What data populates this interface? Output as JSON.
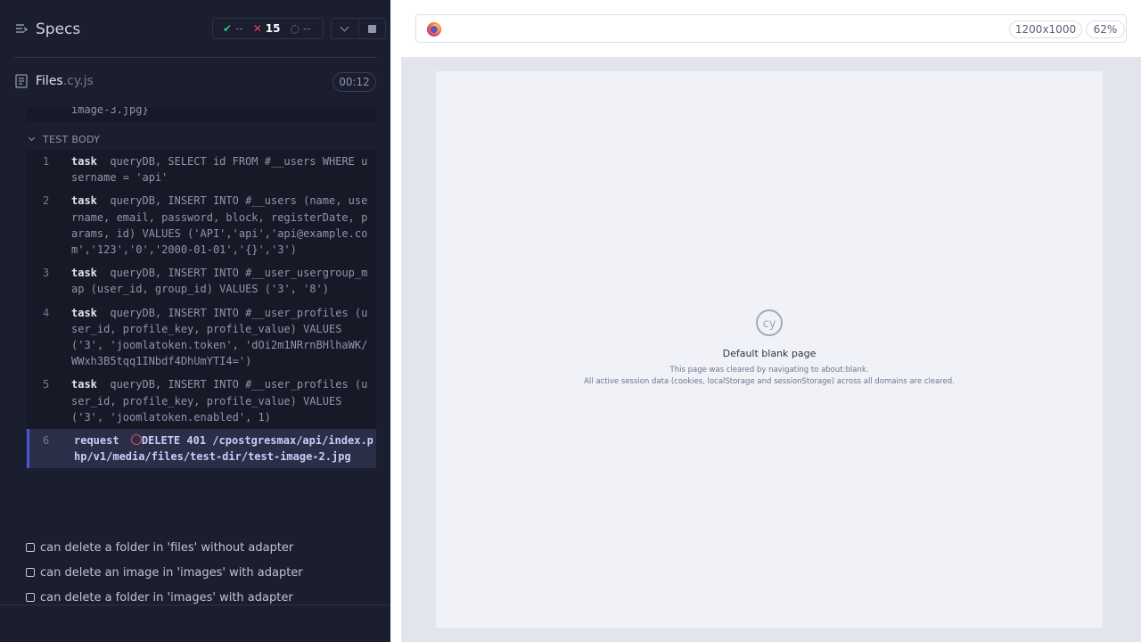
{
  "reporter": {
    "title": "Specs",
    "stats": {
      "passed": "--",
      "failed": "15",
      "pending": "--"
    },
    "file": {
      "name": "Files",
      "ext": ".cy.js",
      "duration": "00:12"
    },
    "prev_tail": "image-3.jpg}",
    "section_title": "TEST BODY",
    "commands": [
      {
        "num": "1",
        "name": "task",
        "text": "queryDB, SELECT id FROM #__users WHERE username = 'api'"
      },
      {
        "num": "2",
        "name": "task",
        "text": "queryDB, INSERT INTO #__users (name, username, email, password, block, registerDate, params, id) VALUES ('API','api','api@example.com','123','0','2000-01-01','{}','3')"
      },
      {
        "num": "3",
        "name": "task",
        "text": "queryDB, INSERT INTO #__user_usergroup_map (user_id, group_id) VALUES ('3', '8')"
      },
      {
        "num": "4",
        "name": "task",
        "text": "queryDB, INSERT INTO #__user_profiles (user_id, profile_key, profile_value) VALUES ('3', 'joomlatoken.token', 'dOi2m1NRrnBHlhaWK/WWxh3B5tqq1INbdf4DhUmYTI4=')"
      },
      {
        "num": "5",
        "name": "task",
        "text": "queryDB, INSERT INTO #__user_profiles (user_id, profile_key, profile_value) VALUES ('3', 'joomlatoken.enabled', 1)"
      },
      {
        "num": "6",
        "name": "request",
        "text": "DELETE 401 /cpostgresmax/api/index.php/v1/media/files/test-dir/test-image-2.jpg"
      }
    ],
    "tests": [
      "can delete a folder in 'files' without adapter",
      "can delete an image in 'images' with adapter",
      "can delete a folder in 'images' with adapter"
    ]
  },
  "aut": {
    "viewport": "1200x1000",
    "zoom": "62%",
    "blank_title": "Default blank page",
    "blank_line1": "This page was cleared by navigating to about:blank.",
    "blank_line2": "All active session data (cookies, localStorage and sessionStorage) across all domains are cleared."
  },
  "colors": {
    "pass": "#2ec27e",
    "fail": "#e04860",
    "accent": "#4956e3"
  },
  "icons": [
    "specs-list-icon",
    "check-icon",
    "x-icon",
    "spinner-icon",
    "chevron-down-icon",
    "stop-icon",
    "document-icon",
    "error-ring-icon",
    "checkbox-icon",
    "firefox-icon",
    "cypress-logo-icon"
  ]
}
